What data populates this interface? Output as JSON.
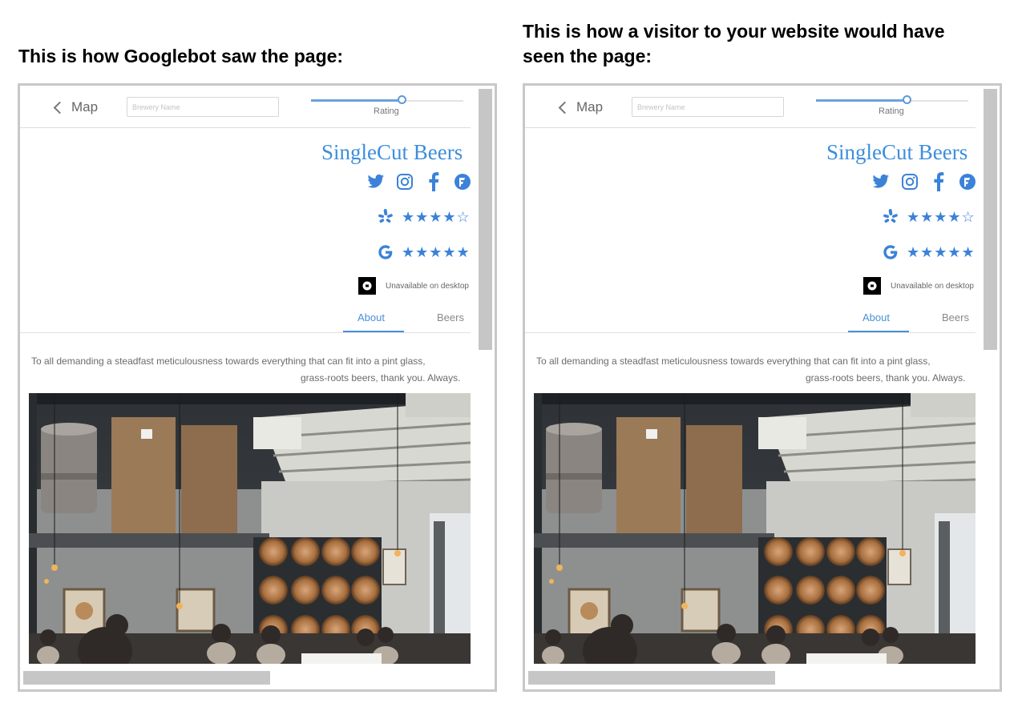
{
  "headings": {
    "left": "This is how Googlebot saw the page:",
    "right": "This is how a visitor to your website would have seen the page:"
  },
  "site": {
    "back_label": "Map",
    "search_placeholder": "Brewery Name",
    "rating_label": "Rating",
    "rating_slider_fraction": 0.6,
    "brewery_name": "SingleCut Beers",
    "socials": [
      "twitter-icon",
      "instagram-icon",
      "facebook-icon",
      "foursquare-icon"
    ],
    "yelp_stars": "★★★★☆",
    "google_stars": "★★★★★",
    "uber_text": "Unavailable on desktop",
    "tabs": {
      "about": "About",
      "beers": "Beers"
    },
    "description": {
      "line1": "To all demanding a steadfast meticulousness towards everything that can fit into a pint glass,",
      "line2": "grass-roots beers, thank you. Always."
    }
  },
  "colors": {
    "accent": "#3b82d8",
    "scrollbar": "#c6c6c6",
    "panel_border": "#c8c8c8"
  }
}
